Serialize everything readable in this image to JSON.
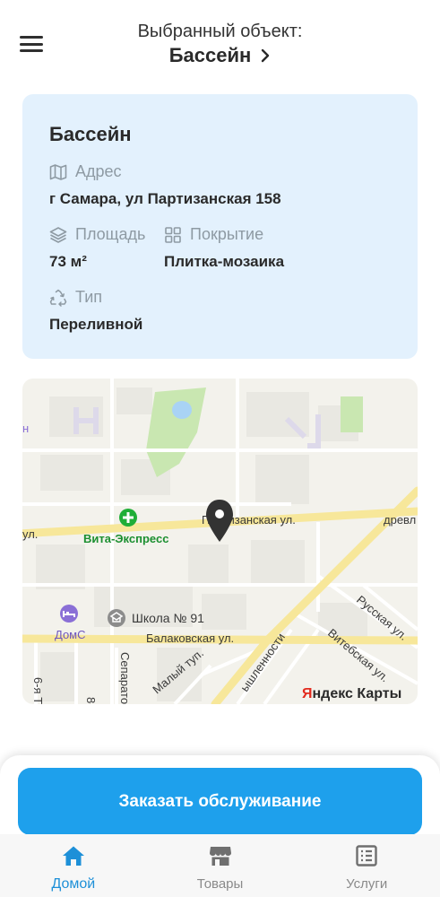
{
  "header": {
    "subtitle": "Выбранный объект:",
    "title": "Бассейн"
  },
  "object_card": {
    "title": "Бассейн",
    "address": {
      "label": "Адрес",
      "value": "г Самара, ул Партизанская 158"
    },
    "area": {
      "label": "Площадь",
      "value": "73 м²"
    },
    "coating": {
      "label": "Покрытие",
      "value": "Плитка-мозаика"
    },
    "type": {
      "label": "Тип",
      "value": "Переливной"
    }
  },
  "map": {
    "streets": {
      "partizanskaya": "Партизанская ул.",
      "partizanskaya_left": "ул.",
      "balakovskaya": "Балаковская ул.",
      "russkaya": "Русская ул.",
      "vitebskaya": "Витебская ул.",
      "separatorny": "Сепарато",
      "maly": "Малый туп.",
      "promyshlennosti": "ышленности",
      "drevl": "древл",
      "six": "6-я Т",
      "eight": "8-"
    },
    "pois": {
      "vita": "Вита-Экспресс",
      "school": "Школа № 91",
      "doms": "ДомС"
    },
    "attribution": {
      "brand_red": "Я",
      "brand_rest": "ндекс Карты"
    },
    "colors": {
      "road_major": "#f7e79a",
      "road_minor": "#ffffff",
      "park": "#c9e7b1",
      "pin": "#333333",
      "poi_green": "#1fae37",
      "poi_violet": "#8a6fd6"
    }
  },
  "actions": {
    "order_label": "Заказать обслуживание"
  },
  "tabs": [
    {
      "label": "Домой",
      "icon": "home-icon",
      "active": true
    },
    {
      "label": "Товары",
      "icon": "store-icon",
      "active": false
    },
    {
      "label": "Услуги",
      "icon": "list-icon",
      "active": false
    }
  ],
  "colors": {
    "accent": "#1ea0ec",
    "card_bg": "#e3f1fd",
    "tab_active": "#1e90d8"
  }
}
